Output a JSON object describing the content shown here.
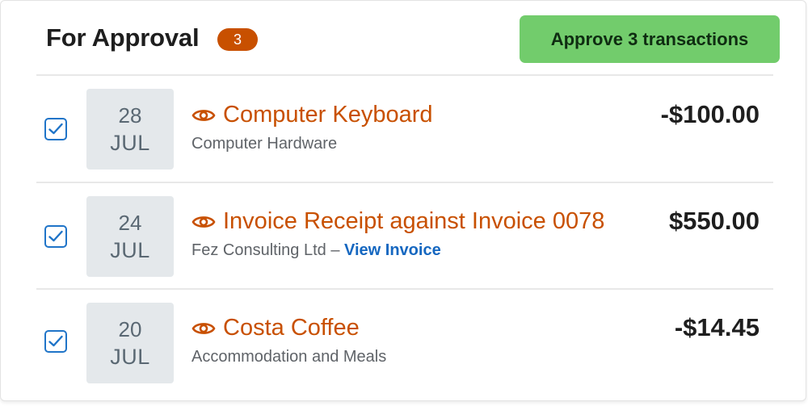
{
  "header": {
    "title": "For Approval",
    "count": "3",
    "approve_button": "Approve 3 transactions"
  },
  "transactions": [
    {
      "checked": true,
      "day": "28",
      "month": "JUL",
      "title": "Computer Keyboard",
      "subtitle": "Computer Hardware",
      "amount": "-$100.00"
    },
    {
      "checked": true,
      "day": "24",
      "month": "JUL",
      "title": "Invoice Receipt against Invoice 0078",
      "subtitle": "Fez Consulting Ltd –",
      "link": "View Invoice",
      "amount": "$550.00"
    },
    {
      "checked": true,
      "day": "20",
      "month": "JUL",
      "title": "Costa Coffee",
      "subtitle": "Accommodation and Meals",
      "amount": "-$14.45"
    }
  ],
  "icons": {
    "view": "eye-icon",
    "checkbox": "checkmark-icon"
  },
  "colors": {
    "accent": "#c85000",
    "approve_button": "#72cc6c",
    "link": "#1567c0",
    "checkbox": "#1f74c8",
    "date_box": "#e4e8eb"
  }
}
